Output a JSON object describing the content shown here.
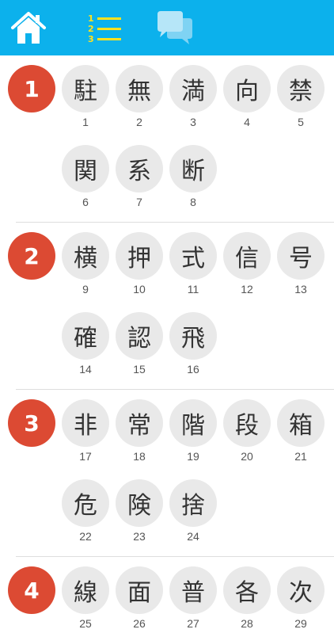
{
  "toolbar": {
    "home_icon": "home-icon",
    "list_icon": "numbered-list-icon",
    "list_numbers": [
      "1",
      "2",
      "3"
    ],
    "chat_icon": "chat-bubbles-icon",
    "colors": {
      "bar": "#0cb1ec",
      "icons": "#ffffff",
      "list_accent": "#ffe21f"
    }
  },
  "colors": {
    "badge": "#dc4a33",
    "kanji_bg": "#e9e9e9",
    "divider": "#dedede"
  },
  "lessons": [
    {
      "number": "1",
      "kanji": [
        {
          "char": "駐",
          "index": "1"
        },
        {
          "char": "無",
          "index": "2"
        },
        {
          "char": "満",
          "index": "3"
        },
        {
          "char": "向",
          "index": "4"
        },
        {
          "char": "禁",
          "index": "5"
        },
        {
          "char": "関",
          "index": "6"
        },
        {
          "char": "系",
          "index": "7"
        },
        {
          "char": "断",
          "index": "8"
        }
      ]
    },
    {
      "number": "2",
      "kanji": [
        {
          "char": "横",
          "index": "9"
        },
        {
          "char": "押",
          "index": "10"
        },
        {
          "char": "式",
          "index": "11"
        },
        {
          "char": "信",
          "index": "12"
        },
        {
          "char": "号",
          "index": "13"
        },
        {
          "char": "確",
          "index": "14"
        },
        {
          "char": "認",
          "index": "15"
        },
        {
          "char": "飛",
          "index": "16"
        }
      ]
    },
    {
      "number": "3",
      "kanji": [
        {
          "char": "非",
          "index": "17"
        },
        {
          "char": "常",
          "index": "18"
        },
        {
          "char": "階",
          "index": "19"
        },
        {
          "char": "段",
          "index": "20"
        },
        {
          "char": "箱",
          "index": "21"
        },
        {
          "char": "危",
          "index": "22"
        },
        {
          "char": "険",
          "index": "23"
        },
        {
          "char": "捨",
          "index": "24"
        }
      ]
    },
    {
      "number": "4",
      "kanji": [
        {
          "char": "線",
          "index": "25"
        },
        {
          "char": "面",
          "index": "26"
        },
        {
          "char": "普",
          "index": "27"
        },
        {
          "char": "各",
          "index": "28"
        },
        {
          "char": "次",
          "index": "29"
        }
      ]
    }
  ]
}
